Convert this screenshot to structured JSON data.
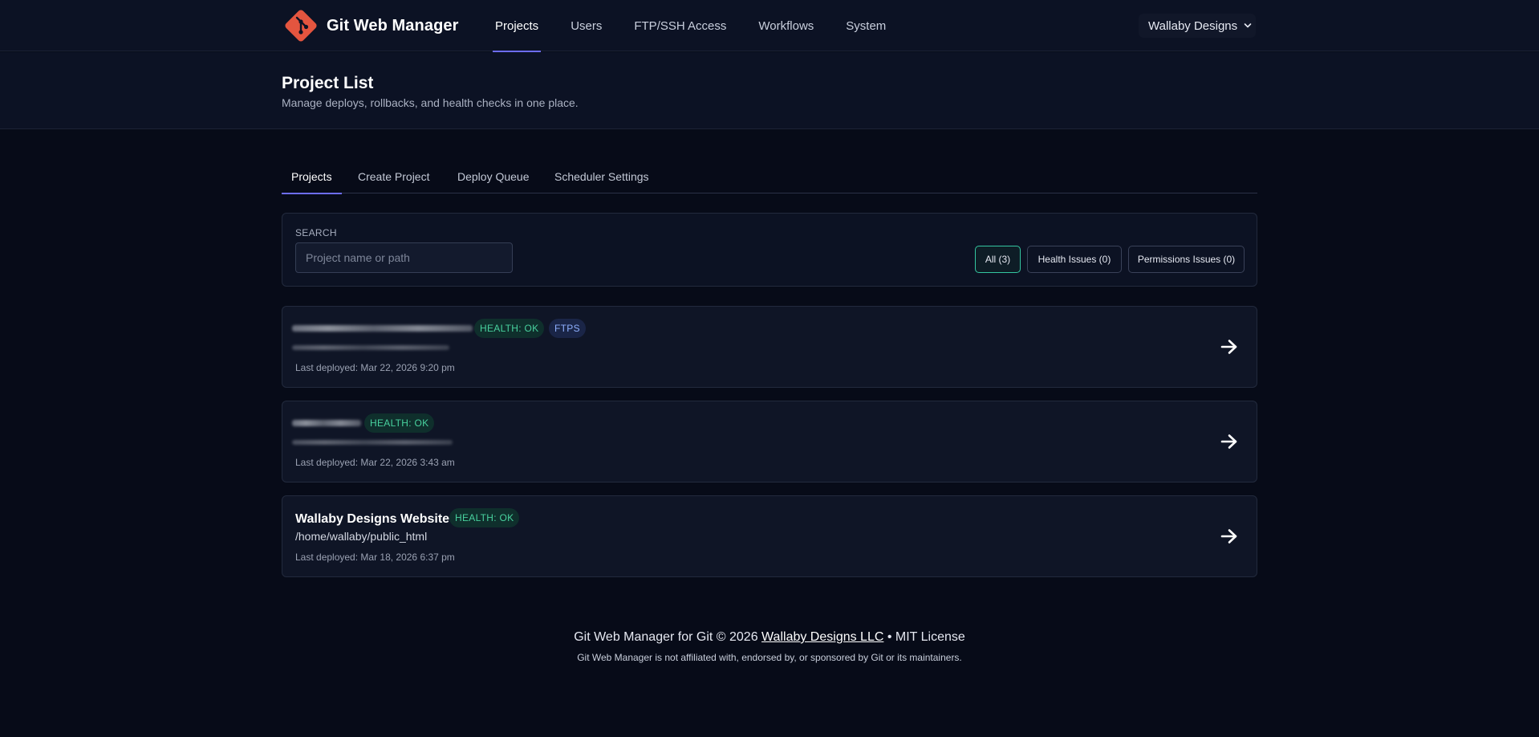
{
  "app": {
    "name": "Git Web Manager"
  },
  "nav": {
    "items": [
      {
        "label": "Projects",
        "active": true
      },
      {
        "label": "Users"
      },
      {
        "label": "FTP/SSH Access"
      },
      {
        "label": "Workflows"
      },
      {
        "label": "System"
      }
    ],
    "account": "Wallaby Designs"
  },
  "header": {
    "title": "Project List",
    "subtitle": "Manage deploys, rollbacks, and health checks in one place."
  },
  "tabs": [
    {
      "label": "Projects",
      "active": true
    },
    {
      "label": "Create Project"
    },
    {
      "label": "Deploy Queue"
    },
    {
      "label": "Scheduler Settings"
    }
  ],
  "search": {
    "label": "SEARCH",
    "placeholder": "Project name or path",
    "value": ""
  },
  "filters": [
    {
      "label": "All (3)",
      "active": true
    },
    {
      "label": "Health Issues (0)"
    },
    {
      "label": "Permissions Issues (0)"
    }
  ],
  "projects": [
    {
      "name": "",
      "path": "",
      "redacted": true,
      "badges": [
        "HEALTH: OK",
        "FTPS"
      ],
      "last_deployed": "Last deployed: Mar 22, 2026 9:20 pm"
    },
    {
      "name": "",
      "path": "",
      "redacted": true,
      "badges": [
        "HEALTH: OK"
      ],
      "last_deployed": "Last deployed: Mar 22, 2026 3:43 am"
    },
    {
      "name": "Wallaby Designs Website",
      "path": "/home/wallaby/public_html",
      "redacted": false,
      "badges": [
        "HEALTH: OK"
      ],
      "last_deployed": "Last deployed: Mar 18, 2026 6:37 pm"
    }
  ],
  "footer": {
    "prefix": "Git Web Manager for Git © 2026",
    "company": "Wallaby Designs LLC",
    "suffix": "• MIT License",
    "disclaimer": "Git Web Manager is not affiliated with, endorsed by, or sponsored by Git or its maintainers."
  },
  "colors": {
    "background": "#070b18",
    "accent": "#6d6df5",
    "health_ok": "#48d19e",
    "logo": "#e4553f"
  },
  "icons": [
    "git-logo-icon",
    "chevron-down-icon",
    "arrow-right-icon"
  ]
}
